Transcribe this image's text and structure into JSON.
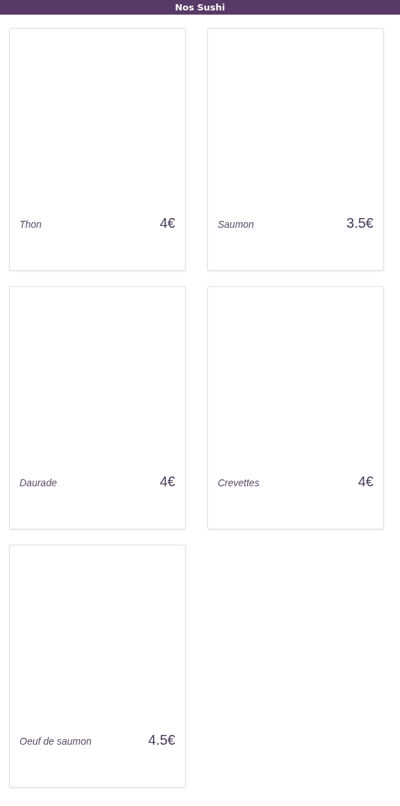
{
  "header": {
    "title": "Nos Sushi"
  },
  "items": [
    {
      "name": "Thon",
      "price": "4€"
    },
    {
      "name": "Saumon",
      "price": "3.5€"
    },
    {
      "name": "Daurade",
      "price": "4€"
    },
    {
      "name": "Crevettes",
      "price": "4€"
    },
    {
      "name": "Oeuf de saumon",
      "price": "4.5€"
    }
  ]
}
